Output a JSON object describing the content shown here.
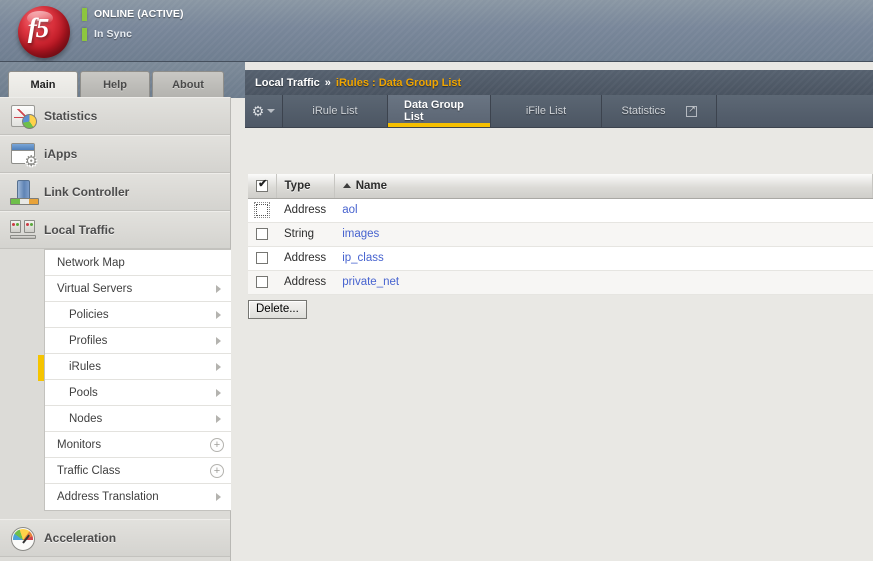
{
  "banner": {
    "logo_text": "f5",
    "status_primary": "ONLINE (ACTIVE)",
    "status_secondary": "In Sync",
    "status_color": "#8dc63f"
  },
  "nav_tabs": [
    {
      "label": "Main",
      "active": true
    },
    {
      "label": "Help",
      "active": false
    },
    {
      "label": "About",
      "active": false
    }
  ],
  "sidebar": {
    "modules": [
      {
        "label": "Statistics",
        "icon": "statistics-icon"
      },
      {
        "label": "iApps",
        "icon": "iapps-icon"
      },
      {
        "label": "Link Controller",
        "icon": "link-controller-icon"
      },
      {
        "label": "Local Traffic",
        "icon": "local-traffic-icon"
      },
      {
        "label": "Acceleration",
        "icon": "acceleration-icon"
      }
    ],
    "submenu": [
      {
        "label": "Network Map",
        "affordance": "none",
        "indent": false,
        "active": false
      },
      {
        "label": "Virtual Servers",
        "affordance": "arrow",
        "indent": false,
        "active": false
      },
      {
        "label": "Policies",
        "affordance": "arrow",
        "indent": true,
        "active": false
      },
      {
        "label": "Profiles",
        "affordance": "arrow",
        "indent": true,
        "active": false
      },
      {
        "label": "iRules",
        "affordance": "arrow",
        "indent": true,
        "active": true
      },
      {
        "label": "Pools",
        "affordance": "arrow",
        "indent": true,
        "active": false
      },
      {
        "label": "Nodes",
        "affordance": "arrow",
        "indent": true,
        "active": false
      },
      {
        "label": "Monitors",
        "affordance": "plus",
        "indent": false,
        "active": false
      },
      {
        "label": "Traffic Class",
        "affordance": "plus",
        "indent": false,
        "active": false
      },
      {
        "label": "Address Translation",
        "affordance": "arrow",
        "indent": false,
        "active": false
      }
    ],
    "active_indicator_color": "#f5c400"
  },
  "breadcrumb": {
    "root": "Local Traffic",
    "separator": "»",
    "current": "iRules : Data Group List",
    "current_color": "#f0a500"
  },
  "content_tabs": [
    {
      "label": "iRule List",
      "active": false,
      "external": false
    },
    {
      "label": "Data Group List",
      "active": true,
      "external": false
    },
    {
      "label": "iFile List",
      "active": false,
      "external": false
    },
    {
      "label": "Statistics",
      "active": false,
      "external": true
    }
  ],
  "table": {
    "columns": [
      {
        "key": "checkbox",
        "label": ""
      },
      {
        "key": "type",
        "label": "Type"
      },
      {
        "key": "name",
        "label": "Name"
      }
    ],
    "sort": {
      "column": "Name",
      "direction": "ascending",
      "glyph": "▲"
    },
    "header_checkbox_checked": true,
    "rows": [
      {
        "checked": false,
        "focused": true,
        "type": "Address",
        "name": "aol"
      },
      {
        "checked": false,
        "focused": false,
        "type": "String",
        "name": "images"
      },
      {
        "checked": false,
        "focused": false,
        "type": "Address",
        "name": "ip_class"
      },
      {
        "checked": false,
        "focused": false,
        "type": "Address",
        "name": "private_net"
      }
    ],
    "link_color": "#4763cf"
  },
  "actions": {
    "delete_label": "Delete..."
  }
}
